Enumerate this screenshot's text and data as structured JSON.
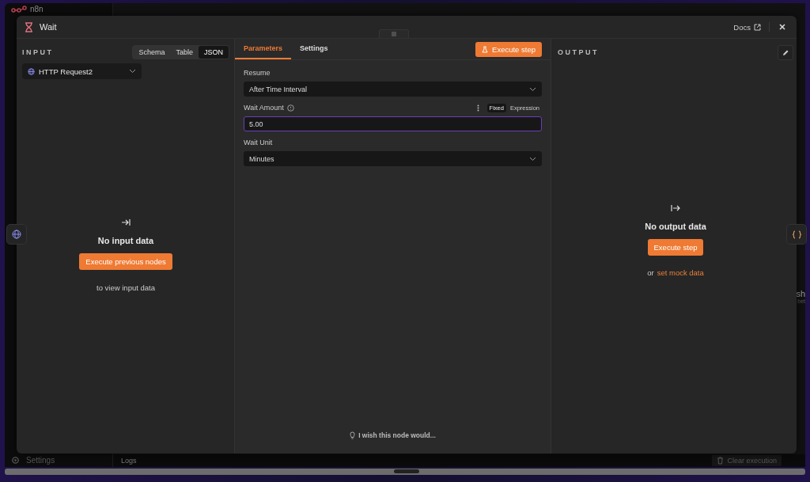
{
  "app": {
    "logo": "n8n",
    "sidebar_items": [
      "Settings"
    ],
    "logs_label": "Logs",
    "clear_execution": "Clear execution",
    "canvas_fragments": [
      "sh",
      "bet"
    ]
  },
  "modal": {
    "title": "Wait",
    "docs": "Docs"
  },
  "input": {
    "heading": "INPUT",
    "view_tabs": [
      {
        "label": "Schema",
        "selected": false
      },
      {
        "label": "Table",
        "selected": false
      },
      {
        "label": "JSON",
        "selected": true
      }
    ],
    "source": "HTTP Request2",
    "empty_title": "No input data",
    "button": "Execute previous nodes",
    "hint": "to view input data"
  },
  "parameters": {
    "tabs": [
      {
        "label": "Parameters",
        "selected": true
      },
      {
        "label": "Settings",
        "selected": false
      }
    ],
    "execute": "Execute step",
    "fields": [
      {
        "kind": "select",
        "label": "Resume",
        "value": "After Time Interval"
      },
      {
        "kind": "number",
        "label": "Wait Amount",
        "value": "5.00",
        "help": true,
        "focused": true,
        "modes": [
          {
            "label": "Fixed",
            "selected": true
          },
          {
            "label": "Expression",
            "selected": false
          }
        ]
      },
      {
        "kind": "select",
        "label": "Wait Unit",
        "value": "Minutes"
      }
    ],
    "feedback": "I wish this node would..."
  },
  "output": {
    "heading": "OUTPUT",
    "empty_title": "No output data",
    "button": "Execute step",
    "mock_prefix": "or",
    "mock_link": "set mock data"
  }
}
